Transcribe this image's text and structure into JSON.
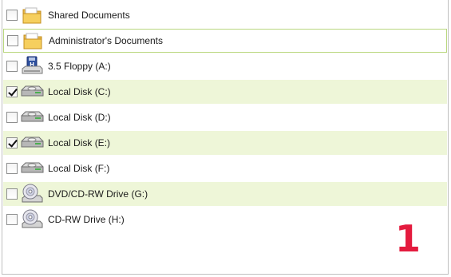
{
  "items": [
    {
      "label": "Shared Documents",
      "checked": false,
      "icon": "folder-icon"
    },
    {
      "label": "Administrator's Documents",
      "checked": false,
      "icon": "folder-icon"
    },
    {
      "label": "3.5 Floppy (A:)",
      "checked": false,
      "icon": "floppy-drive-icon"
    },
    {
      "label": "Local Disk (C:)",
      "checked": true,
      "icon": "hard-disk-icon"
    },
    {
      "label": "Local Disk (D:)",
      "checked": false,
      "icon": "hard-disk-icon"
    },
    {
      "label": "Local Disk (E:)",
      "checked": true,
      "icon": "hard-disk-icon"
    },
    {
      "label": "Local Disk (F:)",
      "checked": false,
      "icon": "hard-disk-icon"
    },
    {
      "label": "DVD/CD-RW Drive (G:)",
      "checked": false,
      "icon": "cd-drive-icon"
    },
    {
      "label": "CD-RW Drive (H:)",
      "checked": false,
      "icon": "cd-drive-icon"
    }
  ],
  "annotation": {
    "step_number": "1"
  },
  "colors": {
    "selected_row": "#eef6d8",
    "focus_border": "#b9d77e",
    "step_number": "#e41b3e"
  }
}
